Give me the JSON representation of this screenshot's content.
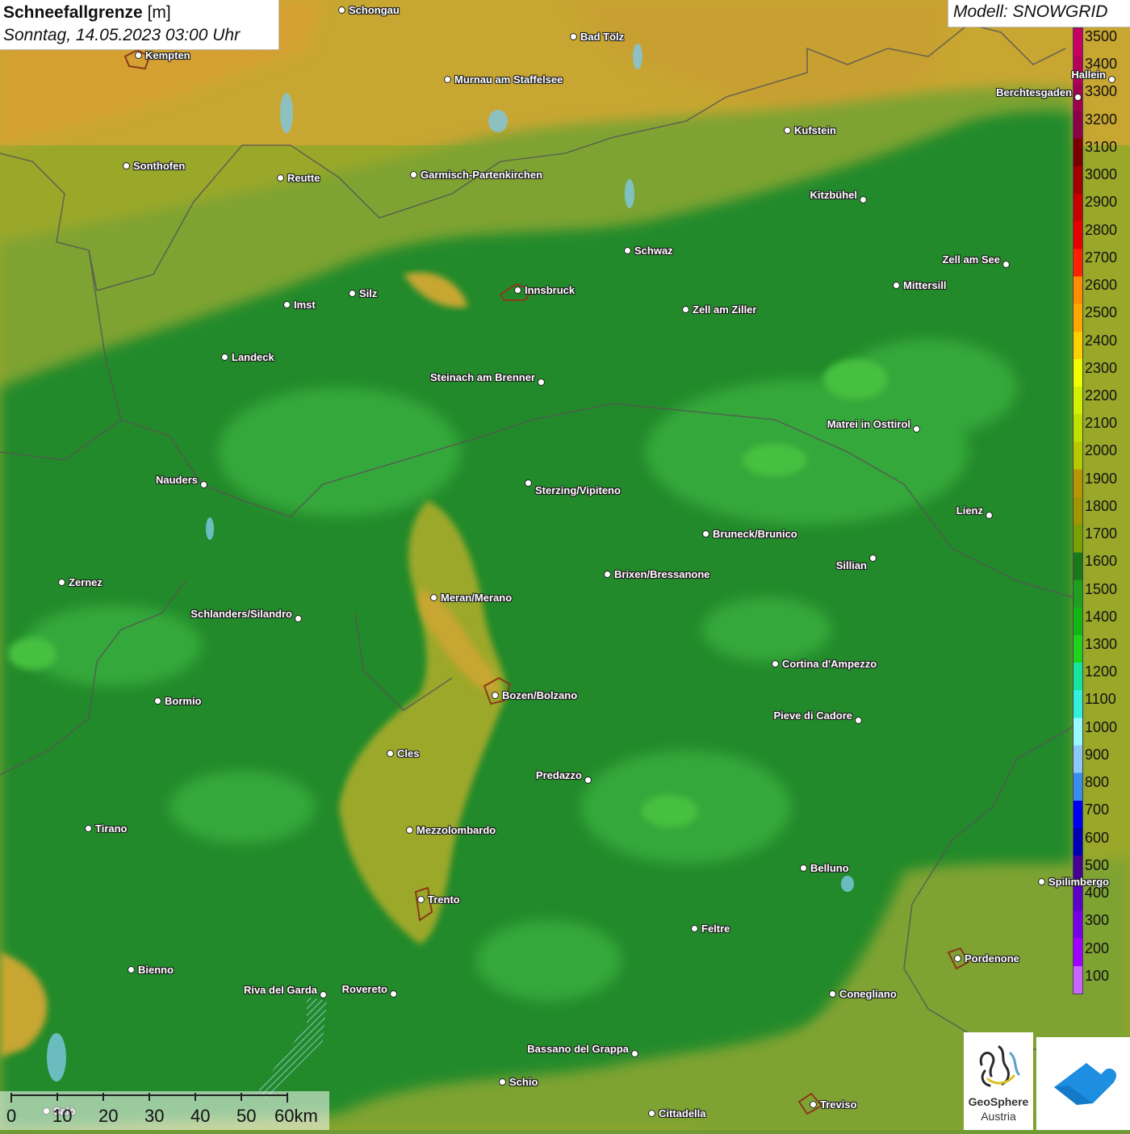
{
  "header": {
    "title_bold": "Schneefallgrenze",
    "title_unit": "[m]",
    "datetime": "Sonntag, 14.05.2023 03:00 Uhr",
    "model": "Modell: SNOWGRID"
  },
  "legend": {
    "labels": [
      "3500",
      "3400",
      "3300",
      "3200",
      "3100",
      "3000",
      "2900",
      "2800",
      "2700",
      "2600",
      "2500",
      "2400",
      "2300",
      "2200",
      "2100",
      "2000",
      "1900",
      "1800",
      "1700",
      "1600",
      "1500",
      "1400",
      "1300",
      "1200",
      "1100",
      "1000",
      "900",
      "800",
      "700",
      "600",
      "500",
      "400",
      "300",
      "200",
      "100"
    ],
    "colors": [
      "#c80064",
      "#b4005a",
      "#a00050",
      "#8c0046",
      "#7a0000",
      "#a00000",
      "#c80000",
      "#e60000",
      "#ff2200",
      "#ff8c00",
      "#ffa800",
      "#ffd000",
      "#f0ff00",
      "#d2f000",
      "#c0e000",
      "#b8c800",
      "#b89600",
      "#a09600",
      "#78a000",
      "#197819",
      "#1ea01e",
      "#14b414",
      "#1ed21e",
      "#14e6a0",
      "#32f0dc",
      "#96faff",
      "#8cc8fa",
      "#3c8cf0",
      "#0000f0",
      "#0000b4",
      "#460096",
      "#5a00c8",
      "#7800e6",
      "#a000ff",
      "#c864ff"
    ]
  },
  "cities": [
    {
      "name": "Schongau"
    },
    {
      "name": "Bad Tölz"
    },
    {
      "name": "Kempten"
    },
    {
      "name": "Murnau am Staffelsee"
    },
    {
      "name": "Hallein"
    },
    {
      "name": "Berchtesgaden"
    },
    {
      "name": "Kufstein"
    },
    {
      "name": "Sonthofen"
    },
    {
      "name": "Reutte"
    },
    {
      "name": "Garmisch-Partenkirchen"
    },
    {
      "name": "Kitzbühel"
    },
    {
      "name": "Schwaz"
    },
    {
      "name": "Zell am See"
    },
    {
      "name": "Mittersill"
    },
    {
      "name": "Innsbruck"
    },
    {
      "name": "Silz"
    },
    {
      "name": "Imst"
    },
    {
      "name": "Zell am Ziller"
    },
    {
      "name": "Landeck"
    },
    {
      "name": "Steinach am Brenner"
    },
    {
      "name": "Matrei in Osttirol"
    },
    {
      "name": "Nauders"
    },
    {
      "name": "Sterzing/Vipiteno"
    },
    {
      "name": "Lienz"
    },
    {
      "name": "Bruneck/Brunico"
    },
    {
      "name": "Sillian"
    },
    {
      "name": "Brixen/Bressanone"
    },
    {
      "name": "Zernez"
    },
    {
      "name": "Meran/Merano"
    },
    {
      "name": "Schlanders/Silandro"
    },
    {
      "name": "Cortina d'Ampezzo"
    },
    {
      "name": "Bozen/Bolzano"
    },
    {
      "name": "Bormio"
    },
    {
      "name": "Pieve di Cadore"
    },
    {
      "name": "Cles"
    },
    {
      "name": "Predazzo"
    },
    {
      "name": "Tirano"
    },
    {
      "name": "Mezzolombardo"
    },
    {
      "name": "Belluno"
    },
    {
      "name": "Spilimbergo"
    },
    {
      "name": "Trento"
    },
    {
      "name": "Feltre"
    },
    {
      "name": "Pordenone"
    },
    {
      "name": "Bienno"
    },
    {
      "name": "Riva del Garda"
    },
    {
      "name": "Rovereto"
    },
    {
      "name": "Conegliano"
    },
    {
      "name": "Bassano del Grappa"
    },
    {
      "name": "Schio"
    },
    {
      "name": "Treviso"
    },
    {
      "name": "Cittadella"
    },
    {
      "name": "Salò"
    }
  ],
  "scale": {
    "labels": [
      "0",
      "10",
      "20",
      "30",
      "40",
      "50",
      "60km"
    ]
  },
  "logos": {
    "org_name_line1": "GeoSphere",
    "org_name_line2": "Austria",
    "org_icon": "geosphere-logo-icon",
    "app_icon": "cloud-arrow-icon"
  }
}
